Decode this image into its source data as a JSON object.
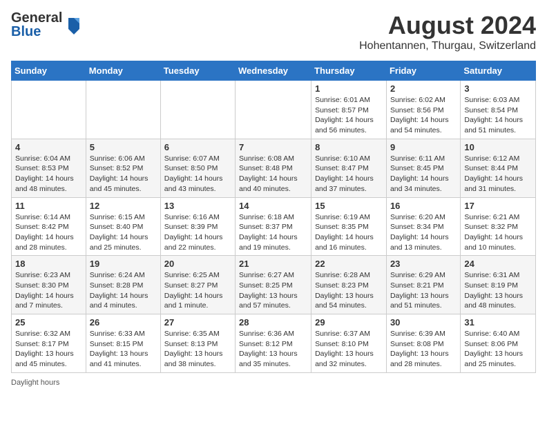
{
  "logo": {
    "general": "General",
    "blue": "Blue"
  },
  "header": {
    "title": "August 2024",
    "subtitle": "Hohentannen, Thurgau, Switzerland"
  },
  "days_of_week": [
    "Sunday",
    "Monday",
    "Tuesday",
    "Wednesday",
    "Thursday",
    "Friday",
    "Saturday"
  ],
  "weeks": [
    [
      {
        "day": "",
        "info": ""
      },
      {
        "day": "",
        "info": ""
      },
      {
        "day": "",
        "info": ""
      },
      {
        "day": "",
        "info": ""
      },
      {
        "day": "1",
        "info": "Sunrise: 6:01 AM\nSunset: 8:57 PM\nDaylight: 14 hours and 56 minutes."
      },
      {
        "day": "2",
        "info": "Sunrise: 6:02 AM\nSunset: 8:56 PM\nDaylight: 14 hours and 54 minutes."
      },
      {
        "day": "3",
        "info": "Sunrise: 6:03 AM\nSunset: 8:54 PM\nDaylight: 14 hours and 51 minutes."
      }
    ],
    [
      {
        "day": "4",
        "info": "Sunrise: 6:04 AM\nSunset: 8:53 PM\nDaylight: 14 hours and 48 minutes."
      },
      {
        "day": "5",
        "info": "Sunrise: 6:06 AM\nSunset: 8:52 PM\nDaylight: 14 hours and 45 minutes."
      },
      {
        "day": "6",
        "info": "Sunrise: 6:07 AM\nSunset: 8:50 PM\nDaylight: 14 hours and 43 minutes."
      },
      {
        "day": "7",
        "info": "Sunrise: 6:08 AM\nSunset: 8:48 PM\nDaylight: 14 hours and 40 minutes."
      },
      {
        "day": "8",
        "info": "Sunrise: 6:10 AM\nSunset: 8:47 PM\nDaylight: 14 hours and 37 minutes."
      },
      {
        "day": "9",
        "info": "Sunrise: 6:11 AM\nSunset: 8:45 PM\nDaylight: 14 hours and 34 minutes."
      },
      {
        "day": "10",
        "info": "Sunrise: 6:12 AM\nSunset: 8:44 PM\nDaylight: 14 hours and 31 minutes."
      }
    ],
    [
      {
        "day": "11",
        "info": "Sunrise: 6:14 AM\nSunset: 8:42 PM\nDaylight: 14 hours and 28 minutes."
      },
      {
        "day": "12",
        "info": "Sunrise: 6:15 AM\nSunset: 8:40 PM\nDaylight: 14 hours and 25 minutes."
      },
      {
        "day": "13",
        "info": "Sunrise: 6:16 AM\nSunset: 8:39 PM\nDaylight: 14 hours and 22 minutes."
      },
      {
        "day": "14",
        "info": "Sunrise: 6:18 AM\nSunset: 8:37 PM\nDaylight: 14 hours and 19 minutes."
      },
      {
        "day": "15",
        "info": "Sunrise: 6:19 AM\nSunset: 8:35 PM\nDaylight: 14 hours and 16 minutes."
      },
      {
        "day": "16",
        "info": "Sunrise: 6:20 AM\nSunset: 8:34 PM\nDaylight: 14 hours and 13 minutes."
      },
      {
        "day": "17",
        "info": "Sunrise: 6:21 AM\nSunset: 8:32 PM\nDaylight: 14 hours and 10 minutes."
      }
    ],
    [
      {
        "day": "18",
        "info": "Sunrise: 6:23 AM\nSunset: 8:30 PM\nDaylight: 14 hours and 7 minutes."
      },
      {
        "day": "19",
        "info": "Sunrise: 6:24 AM\nSunset: 8:28 PM\nDaylight: 14 hours and 4 minutes."
      },
      {
        "day": "20",
        "info": "Sunrise: 6:25 AM\nSunset: 8:27 PM\nDaylight: 14 hours and 1 minute."
      },
      {
        "day": "21",
        "info": "Sunrise: 6:27 AM\nSunset: 8:25 PM\nDaylight: 13 hours and 57 minutes."
      },
      {
        "day": "22",
        "info": "Sunrise: 6:28 AM\nSunset: 8:23 PM\nDaylight: 13 hours and 54 minutes."
      },
      {
        "day": "23",
        "info": "Sunrise: 6:29 AM\nSunset: 8:21 PM\nDaylight: 13 hours and 51 minutes."
      },
      {
        "day": "24",
        "info": "Sunrise: 6:31 AM\nSunset: 8:19 PM\nDaylight: 13 hours and 48 minutes."
      }
    ],
    [
      {
        "day": "25",
        "info": "Sunrise: 6:32 AM\nSunset: 8:17 PM\nDaylight: 13 hours and 45 minutes."
      },
      {
        "day": "26",
        "info": "Sunrise: 6:33 AM\nSunset: 8:15 PM\nDaylight: 13 hours and 41 minutes."
      },
      {
        "day": "27",
        "info": "Sunrise: 6:35 AM\nSunset: 8:13 PM\nDaylight: 13 hours and 38 minutes."
      },
      {
        "day": "28",
        "info": "Sunrise: 6:36 AM\nSunset: 8:12 PM\nDaylight: 13 hours and 35 minutes."
      },
      {
        "day": "29",
        "info": "Sunrise: 6:37 AM\nSunset: 8:10 PM\nDaylight: 13 hours and 32 minutes."
      },
      {
        "day": "30",
        "info": "Sunrise: 6:39 AM\nSunset: 8:08 PM\nDaylight: 13 hours and 28 minutes."
      },
      {
        "day": "31",
        "info": "Sunrise: 6:40 AM\nSunset: 8:06 PM\nDaylight: 13 hours and 25 minutes."
      }
    ]
  ],
  "footer": {
    "daylight_label": "Daylight hours"
  }
}
